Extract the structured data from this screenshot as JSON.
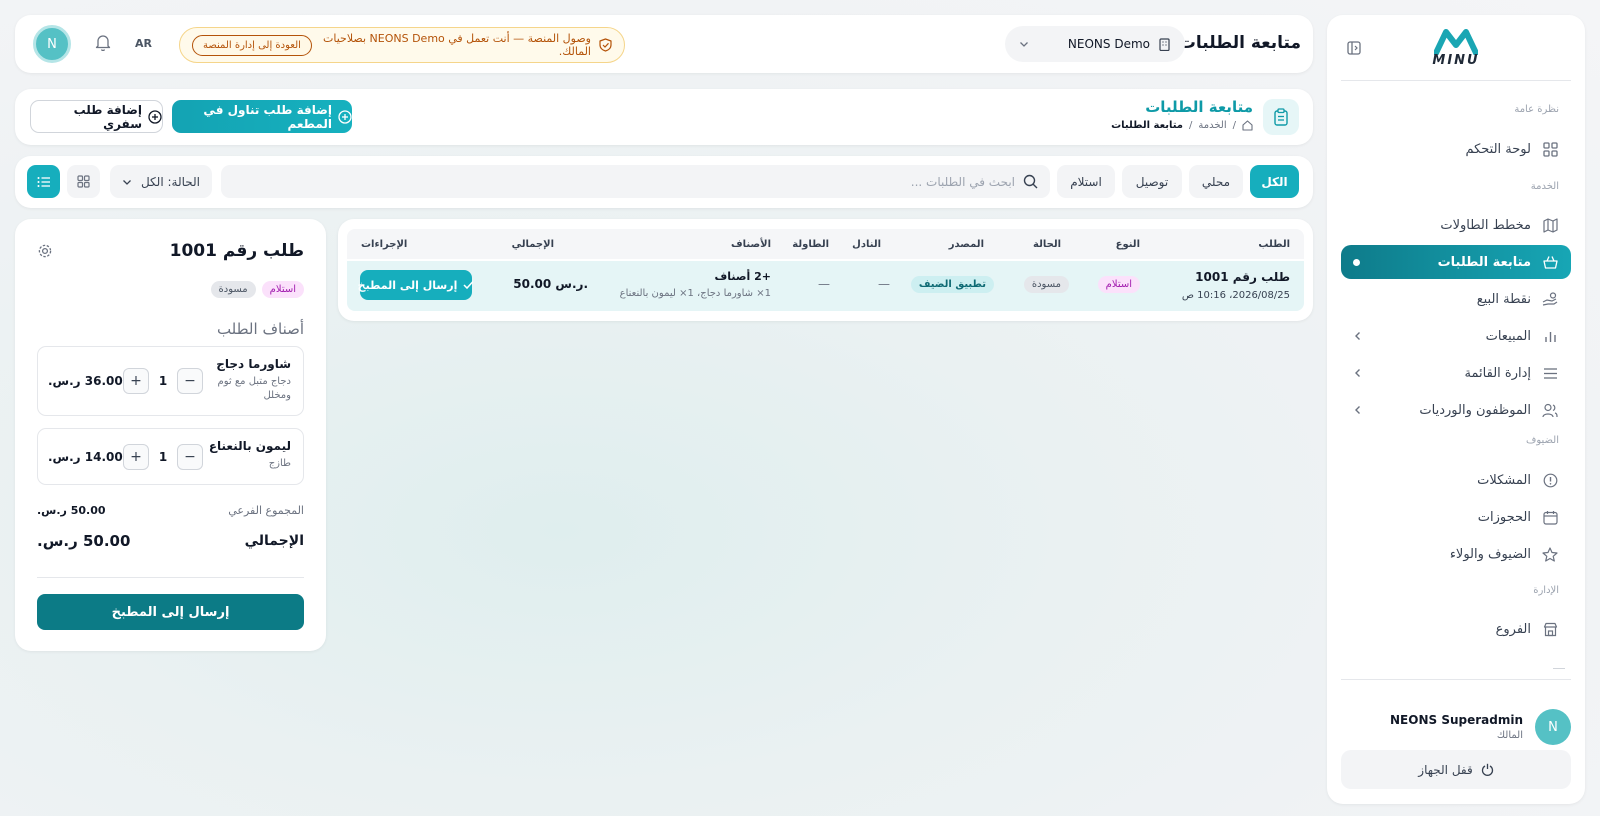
{
  "sidebar": {
    "logo_text": "MINU",
    "sections": {
      "overview": "نظرة عامة",
      "service": "الخدمة",
      "guests": "الضيوف",
      "admin": "الإدارة"
    },
    "items": [
      {
        "label": "لوحة التحكم",
        "icon": "grid-icon"
      },
      {
        "label": "مخطط الطاولات",
        "icon": "map-icon"
      },
      {
        "label": "متابعة الطلبات",
        "icon": "basket-icon",
        "active": true
      },
      {
        "label": "نقطة البيع",
        "icon": "hand-coins-icon"
      },
      {
        "label": "المبيعات",
        "icon": "bar-chart-icon"
      },
      {
        "label": "إدارة القائمة",
        "icon": "list-icon"
      },
      {
        "label": "الموظفون والورديات",
        "icon": "users-icon"
      },
      {
        "label": "المشكلات",
        "icon": "alert-icon"
      },
      {
        "label": "الحجوزات",
        "icon": "calendar-icon"
      },
      {
        "label": "الضيوف والولاء",
        "icon": "star-icon"
      },
      {
        "label": "الفروع",
        "icon": "store-icon"
      }
    ],
    "user": {
      "initial": "N",
      "name": "NEONS Superadmin",
      "role": "المالك"
    },
    "lock_label": "قفل الجهاز"
  },
  "topbar": {
    "title": "متابعة الطلبات",
    "branch": "NEONS Demo",
    "banner_text": "وصول المنصة — أنت تعمل في NEONS Demo بصلاحيات المالك.",
    "banner_button": "العودة إلى إدارة المنصة",
    "lang": "AR",
    "avatar_initial": "N"
  },
  "header": {
    "title": "متابعة الطلبات",
    "breadcrumb": [
      "الخدمة",
      "متابعة الطلبات"
    ],
    "add_dine_in": "إضافة طلب تناول في المطعم",
    "add_takeaway": "إضافة طلب سفري"
  },
  "filters": {
    "tabs": [
      "الكل",
      "محلي",
      "توصيل",
      "استلام"
    ],
    "active_tab": "الكل",
    "search_placeholder": "ابحث في الطلبات ...",
    "status_label": "الحالة: الكل"
  },
  "table": {
    "headers": [
      "الطلب",
      "النوع",
      "الحالة",
      "المصدر",
      "النادل",
      "الطاولة",
      "الأصناف",
      "الإجمالي",
      "الإجراءات"
    ],
    "rows": [
      {
        "order": "طلب رقم 1001",
        "datetime": "2026/08/25، 10:16 ص",
        "type": "استلام",
        "status": "مسودة",
        "source": "تطبيق الضيف",
        "waiter": "—",
        "table": "—",
        "items_count": "+2 أصناف",
        "items_detail": "1× شاورما دجاج، 1× ليمون بالنعناع",
        "total": "50.00 ر.س.",
        "action": "إرسال إلى المطبخ"
      }
    ]
  },
  "order_panel": {
    "title": "طلب رقم 1001",
    "badges": [
      "استلام",
      "مسودة"
    ],
    "subtitle": "أصناف الطلب",
    "items": [
      {
        "name": "شاورما دجاج",
        "desc": "دجاج متبل مع ثوم ومخلل",
        "qty": "1",
        "price": "36.00 ر.س."
      },
      {
        "name": "ليمون بالنعناع",
        "desc": "طازج",
        "qty": "1",
        "price": "14.00 ر.س."
      }
    ],
    "subtotal_label": "المجموع الفرعي",
    "subtotal": "50.00 ر.س.",
    "total_label": "الإجمالي",
    "total": "50.00 ر.س.",
    "send_button": "إرسال إلى المطبخ"
  },
  "colors": {
    "accent": "#16aebd",
    "accent_dark": "#0c7b86",
    "warning": "#b45309"
  }
}
